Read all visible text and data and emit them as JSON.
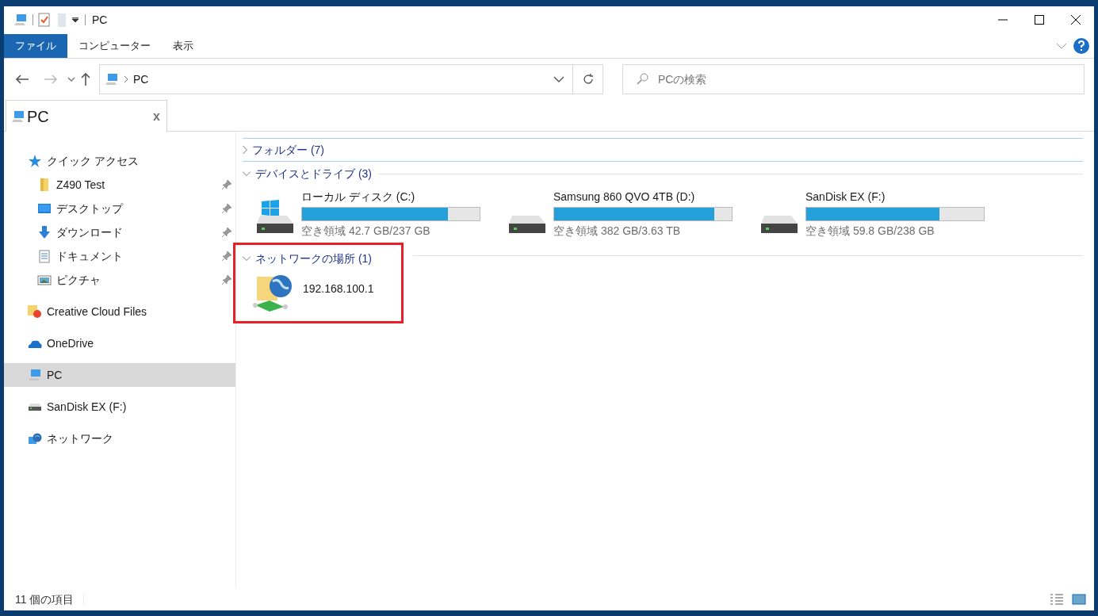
{
  "window": {
    "title": "PC"
  },
  "ribbon_tabs": [
    {
      "label": "ファイル",
      "selected": true
    },
    {
      "label": "コンピューター",
      "selected": false
    },
    {
      "label": "表示",
      "selected": false
    }
  ],
  "address": {
    "path": "PC"
  },
  "search": {
    "placeholder": "PCの検索"
  },
  "view_tab": {
    "label": "PC",
    "close": "x"
  },
  "sidebar": {
    "items": [
      {
        "label": "クイック アクセス",
        "selected": false,
        "children": [
          {
            "label": "Z490 Test",
            "pinned": true,
            "selected": false
          },
          {
            "label": "デスクトップ",
            "pinned": true,
            "selected": false
          },
          {
            "label": "ダウンロード",
            "pinned": true,
            "selected": false
          },
          {
            "label": "ドキュメント",
            "pinned": true,
            "selected": false
          },
          {
            "label": "ピクチャ",
            "pinned": true,
            "selected": false
          }
        ]
      },
      {
        "label": "Creative Cloud Files",
        "selected": false
      },
      {
        "label": "OneDrive",
        "selected": false
      },
      {
        "label": "PC",
        "selected": true
      },
      {
        "label": "SanDisk EX (F:)",
        "selected": false
      },
      {
        "label": "ネットワーク",
        "selected": false
      }
    ]
  },
  "groups": [
    {
      "title": "フォルダー (7)",
      "expanded": false,
      "highlighted": false
    },
    {
      "title": "デバイスとドライブ (3)",
      "expanded": true,
      "highlighted": false,
      "items": [
        {
          "kind": "drive",
          "name": "ローカル ディスク (C:)",
          "level": 0.82,
          "free": "空き領域 42.7 GB/237 GB"
        },
        {
          "kind": "drive",
          "name": "Samsung 860 QVO 4TB (D:)",
          "level": 0.9,
          "free": "空き領域 382 GB/3.63 TB"
        },
        {
          "kind": "drive",
          "name": "SanDisk EX (F:)",
          "level": 0.75,
          "free": "空き領域 59.8 GB/238 GB"
        }
      ]
    },
    {
      "title": "ネットワークの場所 (1)",
      "expanded": true,
      "highlighted": true,
      "items": [
        {
          "kind": "network",
          "name": "192.168.100.1"
        }
      ]
    }
  ],
  "status_bar": {
    "count": "11 個の項目"
  }
}
